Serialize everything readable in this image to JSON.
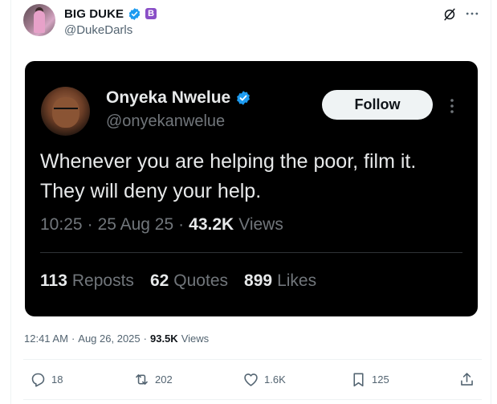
{
  "author": {
    "display_name": "BIG DUKE",
    "handle": "@DukeDarls",
    "badge_letter": "B"
  },
  "quoted": {
    "display_name": "Onyeka Nwelue",
    "handle": "@onyekanwelue",
    "follow_label": "Follow",
    "text": "Whenever you are helping the poor, film it. They will deny your help.",
    "time": "10:25",
    "date": "25 Aug 25",
    "views_count": "43.2K",
    "views_label": "Views",
    "reposts_count": "113",
    "reposts_label": "Reposts",
    "quotes_count": "62",
    "quotes_label": "Quotes",
    "likes_count": "899",
    "likes_label": "Likes"
  },
  "post": {
    "time": "12:41 AM",
    "date": "Aug 26, 2025",
    "views_count": "93.5K",
    "views_label": "Views"
  },
  "actions": {
    "replies": "18",
    "reposts": "202",
    "likes": "1.6K",
    "bookmarks": "125"
  },
  "colors": {
    "verified": "#1d9bf0",
    "badge": "#8a4fc7",
    "card_bg": "#000000",
    "muted": "#536471"
  },
  "icons": [
    "verified-icon",
    "grok-icon",
    "more-icon",
    "reply-icon",
    "repost-icon",
    "like-icon",
    "bookmark-icon",
    "share-icon"
  ]
}
